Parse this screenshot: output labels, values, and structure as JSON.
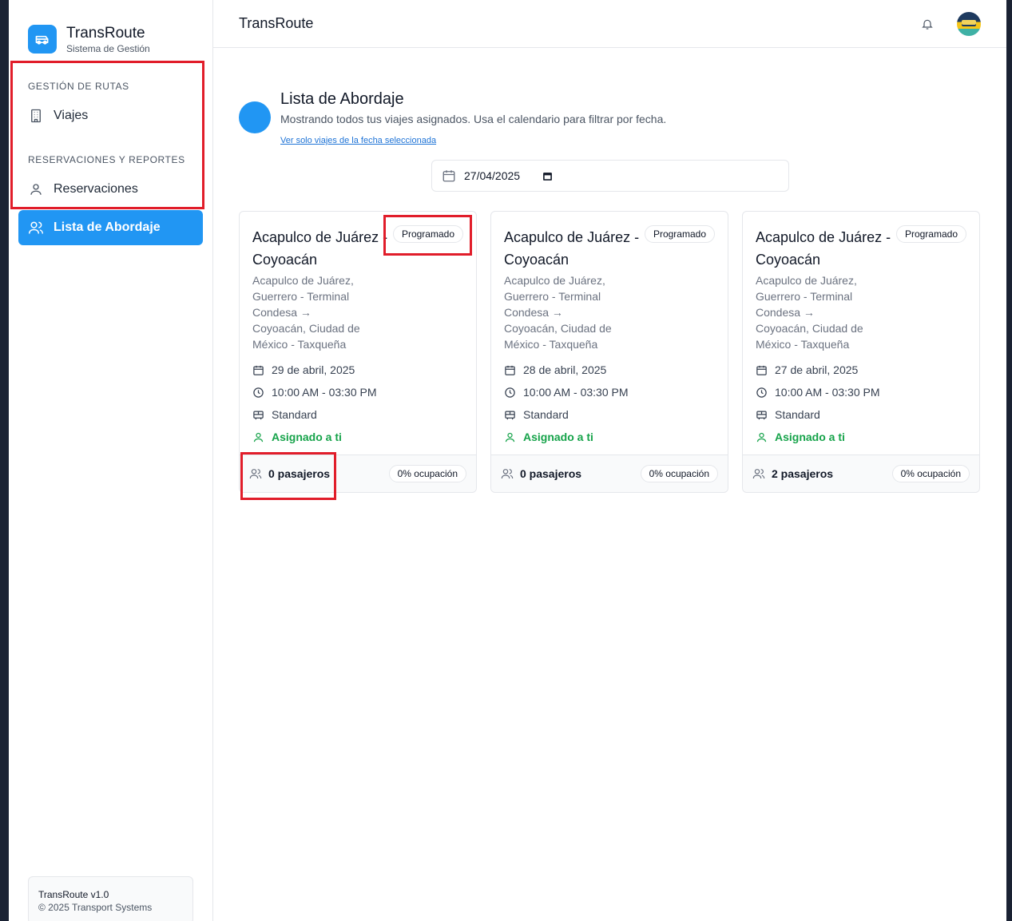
{
  "brand": {
    "title": "TransRoute",
    "subtitle": "Sistema de Gestión"
  },
  "sidebar": {
    "section1": "GESTIÓN DE RUTAS",
    "section2": "RESERVACIONES Y REPORTES",
    "items": [
      {
        "label": "Viajes",
        "icon": "building-icon"
      },
      {
        "label": "Reservaciones",
        "icon": "user-icon"
      },
      {
        "label": "Lista de Abordaje",
        "icon": "users-icon",
        "active": true
      }
    ]
  },
  "version": {
    "line1": "TransRoute v1.0",
    "line2": "© 2025 Transport Systems"
  },
  "topbar": {
    "title": "TransRoute"
  },
  "page": {
    "title": "Lista de Abordaje",
    "subtitle": "Mostrando todos tus viajes asignados. Usa el calendario para filtrar por fecha.",
    "link": "Ver solo viajes de la fecha seleccionada",
    "date_value": "27/04/2025"
  },
  "cards": [
    {
      "title": "Acapulco de Juárez - Coyoacán",
      "status": "Programado",
      "route": "Acapulco de Juárez, Guerrero - Terminal Condesa → Coyoacán, Ciudad de México - Taxqueña",
      "date": "29 de abril, 2025",
      "time": "10:00 AM - 03:30 PM",
      "class": "Standard",
      "assigned": "Asignado a ti",
      "passengers": "0 pasajeros",
      "occupancy": "0% ocupación"
    },
    {
      "title": "Acapulco de Juárez - Coyoacán",
      "status": "Programado",
      "route": "Acapulco de Juárez, Guerrero - Terminal Condesa → Coyoacán, Ciudad de México - Taxqueña",
      "date": "28 de abril, 2025",
      "time": "10:00 AM - 03:30 PM",
      "class": "Standard",
      "assigned": "Asignado a ti",
      "passengers": "0 pasajeros",
      "occupancy": "0% ocupación"
    },
    {
      "title": "Acapulco de Juárez - Coyoacán",
      "status": "Programado",
      "route": "Acapulco de Juárez, Guerrero - Terminal Condesa → Coyoacán, Ciudad de México - Taxqueña",
      "date": "27 de abril, 2025",
      "time": "10:00 AM - 03:30 PM",
      "class": "Standard",
      "assigned": "Asignado a ti",
      "passengers": "2 pasajeros",
      "occupancy": "0% ocupación"
    }
  ],
  "colors": {
    "accent": "#2196f3",
    "assigned": "#16a34a",
    "highlight": "#e11d2a"
  }
}
